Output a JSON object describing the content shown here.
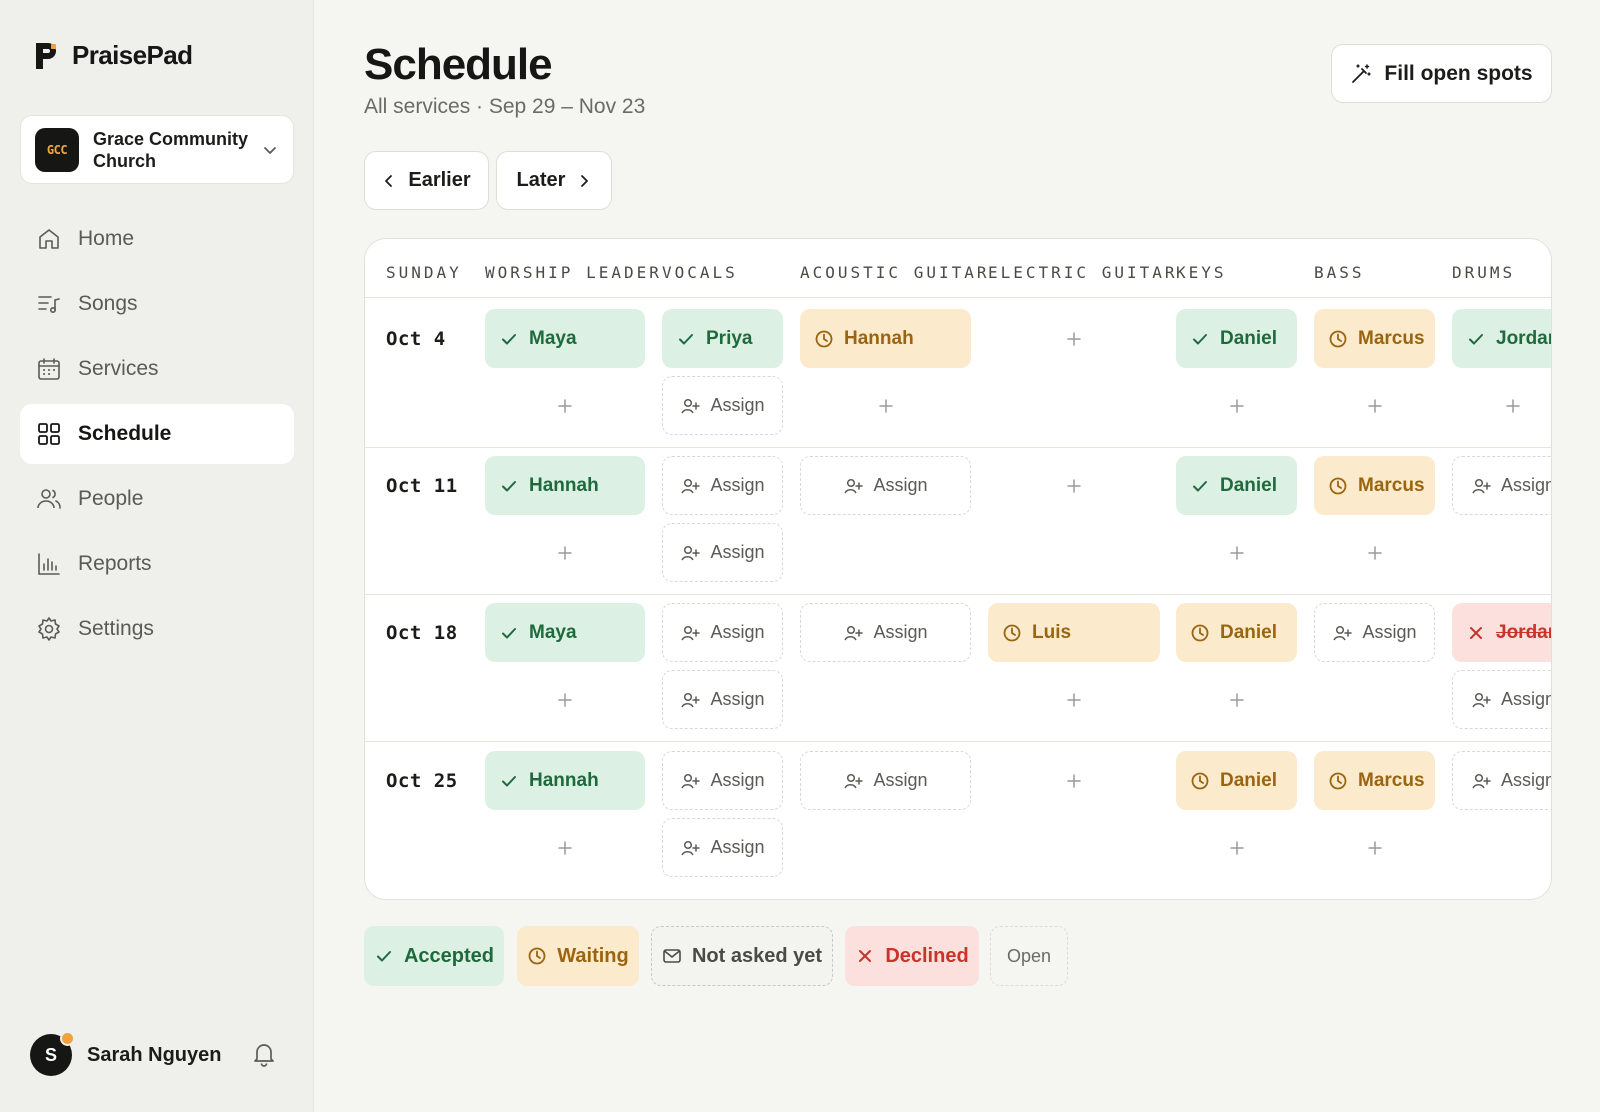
{
  "brand": {
    "name": "PraisePad"
  },
  "org": {
    "initials": "GCC",
    "name": "Grace Community Church"
  },
  "nav": [
    {
      "label": "Home",
      "icon": "home-icon"
    },
    {
      "label": "Songs",
      "icon": "music-list-icon"
    },
    {
      "label": "Services",
      "icon": "calendar-icon"
    },
    {
      "label": "Schedule",
      "icon": "grid-icon",
      "active": true
    },
    {
      "label": "People",
      "icon": "people-icon"
    },
    {
      "label": "Reports",
      "icon": "bar-chart-icon"
    },
    {
      "label": "Settings",
      "icon": "gear-icon"
    }
  ],
  "user": {
    "initial": "S",
    "name": "Sarah Nguyen"
  },
  "page": {
    "title": "Schedule",
    "subtitle": "All services · Sep 29 – Nov 23"
  },
  "actions": {
    "fill_open_spots": "Fill open spots",
    "earlier": "Earlier",
    "later": "Later"
  },
  "columns": [
    "SUNDAY",
    "WORSHIP LEADER",
    "VOCALS",
    "ACOUSTIC GUITAR",
    "ELECTRIC GUITAR",
    "KEYS",
    "BASS",
    "DRUMS"
  ],
  "rows": [
    {
      "date": "Oct 4",
      "slots": [
        [
          {
            "s": "accepted",
            "n": "Maya"
          },
          {
            "s": "plus"
          }
        ],
        [
          {
            "s": "accepted",
            "n": "Priya"
          },
          {
            "s": "assign",
            "n": "Assign"
          }
        ],
        [
          {
            "s": "waiting",
            "n": "Hannah"
          },
          {
            "s": "plus"
          }
        ],
        [
          {
            "s": "plus"
          }
        ],
        [
          {
            "s": "accepted",
            "n": "Daniel"
          },
          {
            "s": "plus"
          }
        ],
        [
          {
            "s": "waiting",
            "n": "Marcus"
          },
          {
            "s": "plus"
          }
        ],
        [
          {
            "s": "accepted",
            "n": "Jordan"
          },
          {
            "s": "plus"
          }
        ]
      ]
    },
    {
      "date": "Oct 11",
      "slots": [
        [
          {
            "s": "accepted",
            "n": "Hannah"
          },
          {
            "s": "plus"
          }
        ],
        [
          {
            "s": "assign",
            "n": "Assign"
          },
          {
            "s": "assign",
            "n": "Assign"
          }
        ],
        [
          {
            "s": "assign",
            "n": "Assign"
          }
        ],
        [
          {
            "s": "plus"
          }
        ],
        [
          {
            "s": "accepted",
            "n": "Daniel"
          },
          {
            "s": "plus"
          }
        ],
        [
          {
            "s": "waiting",
            "n": "Marcus"
          },
          {
            "s": "plus"
          }
        ],
        [
          {
            "s": "assign",
            "n": "Assign"
          }
        ]
      ]
    },
    {
      "date": "Oct 18",
      "slots": [
        [
          {
            "s": "accepted",
            "n": "Maya"
          },
          {
            "s": "plus"
          }
        ],
        [
          {
            "s": "assign",
            "n": "Assign"
          },
          {
            "s": "assign",
            "n": "Assign"
          }
        ],
        [
          {
            "s": "assign",
            "n": "Assign"
          }
        ],
        [
          {
            "s": "waiting",
            "n": "Luis"
          },
          {
            "s": "plus"
          }
        ],
        [
          {
            "s": "waiting",
            "n": "Daniel"
          },
          {
            "s": "plus"
          }
        ],
        [
          {
            "s": "assign",
            "n": "Assign"
          }
        ],
        [
          {
            "s": "declined",
            "n": "Jordan"
          },
          {
            "s": "assign",
            "n": "Assign"
          }
        ]
      ]
    },
    {
      "date": "Oct 25",
      "slots": [
        [
          {
            "s": "accepted",
            "n": "Hannah"
          },
          {
            "s": "plus"
          }
        ],
        [
          {
            "s": "assign",
            "n": "Assign"
          },
          {
            "s": "assign",
            "n": "Assign"
          }
        ],
        [
          {
            "s": "assign",
            "n": "Assign"
          }
        ],
        [
          {
            "s": "plus"
          }
        ],
        [
          {
            "s": "waiting",
            "n": "Daniel"
          },
          {
            "s": "plus"
          }
        ],
        [
          {
            "s": "waiting",
            "n": "Marcus"
          },
          {
            "s": "plus"
          }
        ],
        [
          {
            "s": "assign",
            "n": "Assign"
          }
        ]
      ]
    }
  ],
  "legend": [
    {
      "label": "Accepted",
      "status": "accepted"
    },
    {
      "label": "Waiting",
      "status": "waiting"
    },
    {
      "label": "Not asked yet",
      "status": "not-asked"
    },
    {
      "label": "Declined",
      "status": "declined"
    },
    {
      "label": "Open",
      "status": "open"
    }
  ],
  "colors": {
    "accepted_bg": "#dcf1e4",
    "accepted_fg": "#1f6a3d",
    "waiting_bg": "#fbeacb",
    "waiting_fg": "#9a6510",
    "declined_bg": "#fbe0dd",
    "declined_fg": "#c9342a",
    "accent_orange": "#f0a33a"
  }
}
